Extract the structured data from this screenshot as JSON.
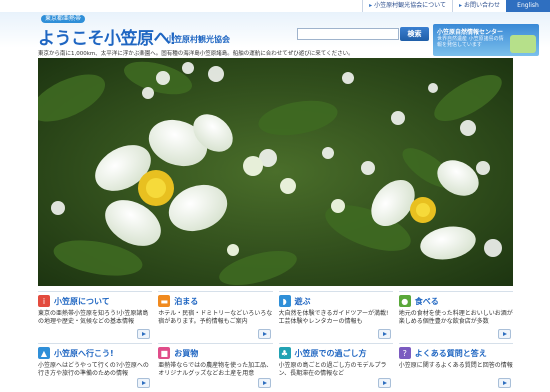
{
  "topnav": {
    "links": [
      "小笠原村観光協会について",
      "お問い合わせ",
      "English"
    ]
  },
  "header": {
    "sub_label": "東京都亜熱帯",
    "title": "ようこそ小笠原へ!",
    "org": "小笠原村観光協会",
    "search_placeholder": "",
    "search_button": "検索",
    "banner_title": "小笠原自然情報センター",
    "banner_text": "世界自然遺産 小笠原諸島の情報を発信しています"
  },
  "tagline": "東京から南に1,000km、太平洋に浮かぶ楽園へ。固有種の海洋島小笠原諸島。船舶の運航に合わせてぜひ遊びに来てください。",
  "colors": {
    "accent": "#1f66c2",
    "icon_red": "#e34b3e",
    "icon_orange": "#f08a1f",
    "icon_blue": "#2f8fd8",
    "icon_green": "#5aa83a",
    "icon_pink": "#e04d8a",
    "icon_teal": "#22a2b3",
    "icon_purple": "#7b5bc0"
  },
  "cards": [
    {
      "icon": "info-icon",
      "color": "#e34b3e",
      "name": "小笠原について",
      "desc": "東京の亜熱帯小笠原を知ろう!小笠原諸島の地理や歴史・気候などの基本情報"
    },
    {
      "icon": "bed-icon",
      "color": "#f08a1f",
      "name": "泊まる",
      "desc": "ホテル・民宿・ドミトリーなどいろいろな宿があります。予約情報もご案内"
    },
    {
      "icon": "dolphin-icon",
      "color": "#2f8fd8",
      "name": "遊ぶ",
      "desc": "大自然を体験できるガイドツアーが満載!工芸体験やレンタカーの情報も"
    },
    {
      "icon": "food-icon",
      "color": "#5aa83a",
      "name": "食べる",
      "desc": "地元の食材を使った料理とおいしいお酒が楽しめる個性豊かな飲食店が多数"
    },
    {
      "icon": "ship-icon",
      "color": "#2f8fd8",
      "name": "小笠原へ行こう!",
      "desc": "小笠原へはどうやって行くの?小笠原への行き方や旅行の準備のための情報"
    },
    {
      "icon": "bag-icon",
      "color": "#e04d8a",
      "name": "お買物",
      "desc": "亜熱帯ならではの農産物を使った加工品、オリジナルグッズなどお土産を用意"
    },
    {
      "icon": "leaf-icon",
      "color": "#22a2b3",
      "name": "小笠原での過ごし方",
      "desc": "小笠原の島ごとの過ごし方のモデルプラン、長期滞在の情報など"
    },
    {
      "icon": "question-icon",
      "color": "#7b5bc0",
      "name": "よくある質問と答え",
      "desc": "小笠原に関するよくある質問と回答の情報"
    }
  ]
}
